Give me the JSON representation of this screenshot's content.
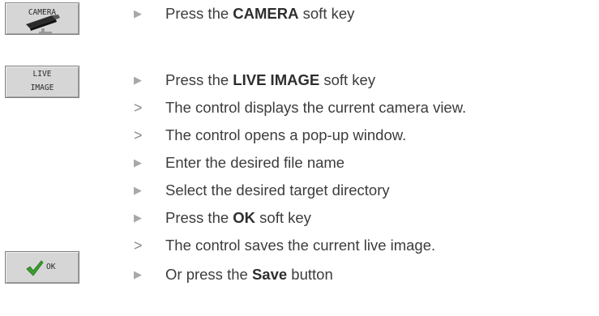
{
  "softkeys": {
    "camera": {
      "label": "CAMERA"
    },
    "live_image": {
      "line1": "LIVE",
      "line2": "IMAGE"
    },
    "ok": {
      "label": "OK"
    }
  },
  "markers": {
    "action": "▶",
    "result": ">"
  },
  "steps": [
    {
      "type": "action",
      "before": "Press the ",
      "bold": "CAMERA",
      "after": " soft key"
    },
    {
      "type": "action",
      "before": "Press the ",
      "bold": "LIVE IMAGE",
      "after": " soft key"
    },
    {
      "type": "result",
      "text": "The control displays the current camera view."
    },
    {
      "type": "result",
      "text": "The control opens a pop-up window."
    },
    {
      "type": "action",
      "text": "Enter the desired file name"
    },
    {
      "type": "action",
      "text": "Select the desired target directory"
    },
    {
      "type": "action",
      "before": "Press the ",
      "bold": "OK",
      "after": " soft key"
    },
    {
      "type": "result",
      "text": "The control saves the current live image."
    },
    {
      "type": "action",
      "before": "Or press the ",
      "bold": "Save",
      "after": " button"
    }
  ]
}
